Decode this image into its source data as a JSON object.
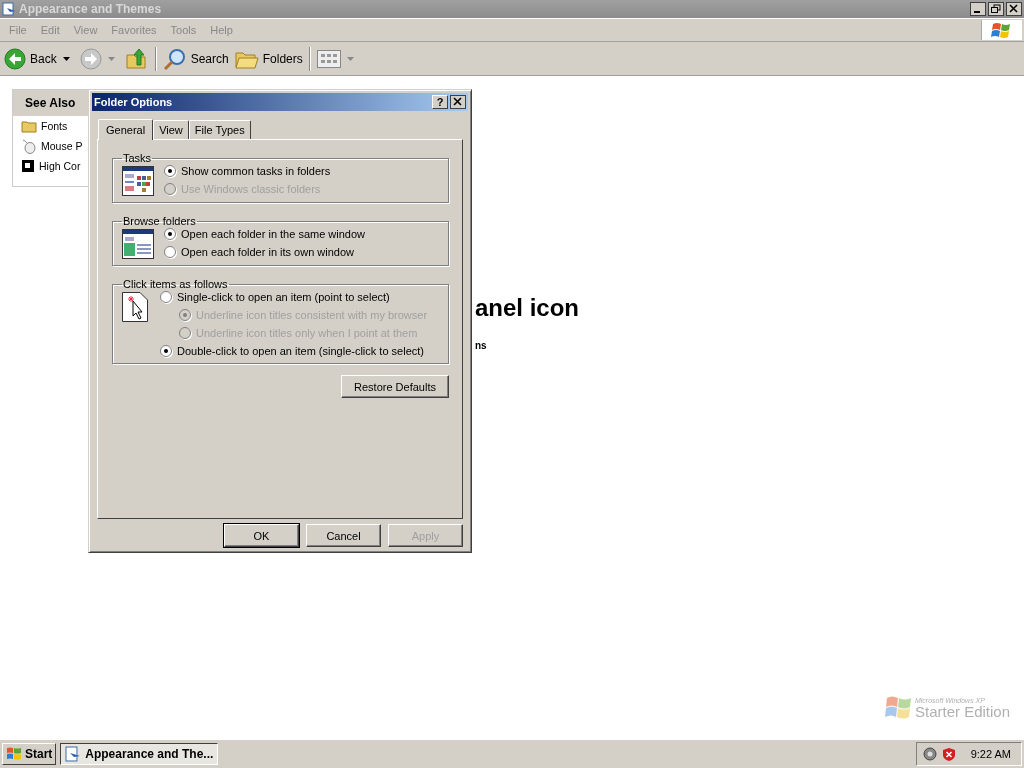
{
  "window": {
    "title": "Appearance and Themes"
  },
  "menu": [
    "File",
    "Edit",
    "View",
    "Favorites",
    "Tools",
    "Help"
  ],
  "toolbar": [
    {
      "kind": "back",
      "label": "Back"
    },
    {
      "kind": "forward"
    },
    {
      "kind": "up"
    },
    {
      "kind": "search",
      "label": "Search"
    },
    {
      "kind": "folders",
      "label": "Folders"
    },
    {
      "kind": "views"
    }
  ],
  "see_also": {
    "title": "See Also",
    "items": [
      {
        "kind": "font",
        "label": "Fonts"
      },
      {
        "kind": "mouse",
        "label": "Mouse P"
      },
      {
        "kind": "contrast",
        "label": "High Cor"
      }
    ]
  },
  "content": {
    "heading": "anel icon",
    "text": "ns"
  },
  "dialog": {
    "title": "Folder Options",
    "help": "?",
    "tabs": [
      {
        "label": "General",
        "selected": true
      },
      {
        "label": "View",
        "selected": false
      },
      {
        "label": "File Types",
        "selected": false
      }
    ],
    "groups": [
      {
        "title": "Tasks",
        "kind": "tasks",
        "options": [
          {
            "label": "Show common tasks in folders",
            "selected": true,
            "disabled": false
          },
          {
            "label": "Use Windows classic folders",
            "selected": false,
            "disabled": true
          }
        ]
      },
      {
        "title": "Browse folders",
        "kind": "browse",
        "options": [
          {
            "label": "Open each folder in the same window",
            "selected": true,
            "disabled": false
          },
          {
            "label": "Open each folder in its own window",
            "selected": false,
            "disabled": false
          }
        ]
      },
      {
        "title": "Click items as follows",
        "kind": "click",
        "options": [
          {
            "label": "Single-click to open an item (point to select)",
            "selected": false,
            "disabled": false,
            "children": [
              {
                "label": "Underline icon titles consistent with my browser",
                "selected": true,
                "disabled": true
              },
              {
                "label": "Underline icon titles only when I point at them",
                "selected": false,
                "disabled": true
              }
            ]
          },
          {
            "label": "Double-click to open an item (single-click to select)",
            "selected": true,
            "disabled": false
          }
        ]
      }
    ],
    "restore": "Restore Defaults",
    "buttons": [
      {
        "label": "OK",
        "default": true,
        "disabled": false
      },
      {
        "label": "Cancel",
        "default": false,
        "disabled": false
      },
      {
        "label": "Apply",
        "default": false,
        "disabled": true
      }
    ]
  },
  "desktop_logo": {
    "brand": "Microsoft Windows XP",
    "edition": "Starter Edition"
  },
  "taskbar": {
    "start": "Start",
    "tasks": [
      {
        "label": "Appearance and The...",
        "selected": true
      }
    ],
    "clock": "9:22 AM"
  }
}
